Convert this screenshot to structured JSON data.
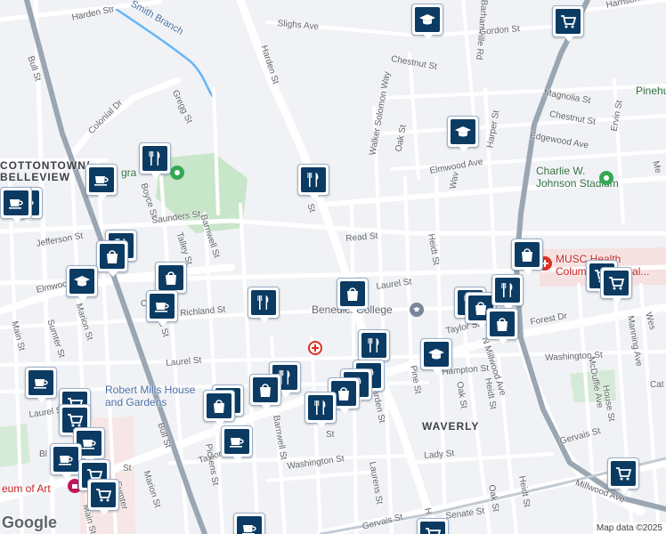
{
  "streets": {
    "harden_st_n": "Harden St",
    "harden_st_mid": "Harden St",
    "harden_st_s": "Harden St",
    "harden_st_top": "Harden Str",
    "sligh_ave": "Slighs Ave",
    "barhamville_rd": "Barhamville Rd",
    "gordon_st": "Gordon St",
    "harrison_rd": "Harrison Rd",
    "chestnut_st_a": "Chestnut St",
    "chestnut_st_b": "Chestnut St",
    "magnolia_st": "Magnolia St",
    "walker_solomon_way": "Walker Solomon Way",
    "oak_st_n": "Oak St",
    "oak_st_mid": "Oak St",
    "oak_st_s": "Oak St",
    "harper_st": "Harper St",
    "edgewood_ave": "Edgewood Ave",
    "ervin_st": "Ervin St",
    "elmwood_ave_e": "Elmwood Ave",
    "elmwood_ave_w": "Elmwood",
    "gregg_st": "Gregg St",
    "colonial_dr": "Colonial Dr",
    "bull_st_n": "Bull St",
    "bull_st_s": "Bull St",
    "boyce_st": "Boyce St",
    "saunders_st": "Saunders St",
    "barnwell_st_n": "Barnwell St",
    "barnwell_st_s": "Barnwell St",
    "talley_st": "Talley St",
    "jefferson_st": "Jefferson St",
    "read_st": "Read St",
    "heidt_st_n": "Heidt St",
    "heidt_st_mid": "Heidt St",
    "heidt_st_s": "Heidt St",
    "laurel_st_e": "Laurel St",
    "laurel_st_w": "Laurel St",
    "laurel_st_far": "Laurel St",
    "richland_st": "Richland St",
    "sumter_st": "Sumter St",
    "marion_st_n": "Marion St",
    "marion_st_s": "Marion St",
    "main_st_n": "Main St",
    "main_st_s": "Main St",
    "taylor_st_w": "Taylor St",
    "taylor_st_e": "Taylor St",
    "forest_dr": "Forest Dr",
    "millwood_ave_n": "N Millwood Ave",
    "millwood_ave_s": "Millwood Ave",
    "hampton_st": "Hampton St",
    "pine_st": "Pine St",
    "washington_st_e": "Washington St",
    "washington_st_w": "Washington St",
    "mcduffie_ave": "McDuffie Ave",
    "house_st": "House St",
    "manning_ave": "Manning Ave",
    "gervais_st_e": "Gervais St",
    "gervais_st_s": "Gervais St",
    "lady_st": "Lady St",
    "laurens_st": "Laurens St",
    "pickens_st": "Pickens St",
    "senate_st": "Senate St",
    "st_frag_a": "St",
    "st_frag_b": "St",
    "st_frag_c": "St",
    "st_frag_d": "Sh",
    "cat_frag": "Cat",
    "wes_frag": "Wes",
    "me_frag": "Me",
    "wav_frag": "Wav",
    "h_frag": "H",
    "c_frag": "C",
    "rens_frag": "ens St",
    "nter_frag": "Sumter",
    "harden_left": "Harden St",
    "ben_frag": "Bl"
  },
  "areas": {
    "cottontown": "COTTONTOWN/\nBELLEVIEW",
    "waverly": "WAVERLY"
  },
  "pois": {
    "smith_branch": "Smith Branch",
    "benedict_college": "Benedict College",
    "robert_mills": "Robert Mills House\nand Gardens",
    "charlie_johnson": "Charlie W.\nJohnson Stadium",
    "musc": "MUSC Health\nColumbia Medical...",
    "pinehurst": "Pinehu",
    "museum": "eum of Art",
    "gra": "gra"
  },
  "attribution": "Map data ©2025",
  "logo": "Google",
  "icons": {
    "shopping": "shopping-bag-icon",
    "restaurant": "fork-knife-icon",
    "cafe": "coffee-cup-icon",
    "school": "graduation-cap-icon",
    "grocery": "shopping-cart-icon"
  },
  "colors": {
    "pin_fill": "#0b3b63",
    "road": "#ffffff",
    "highway": "#9aa6b2",
    "park": "#c8e6c9",
    "water": "#64b5f6",
    "background": "#f1f2f5"
  }
}
